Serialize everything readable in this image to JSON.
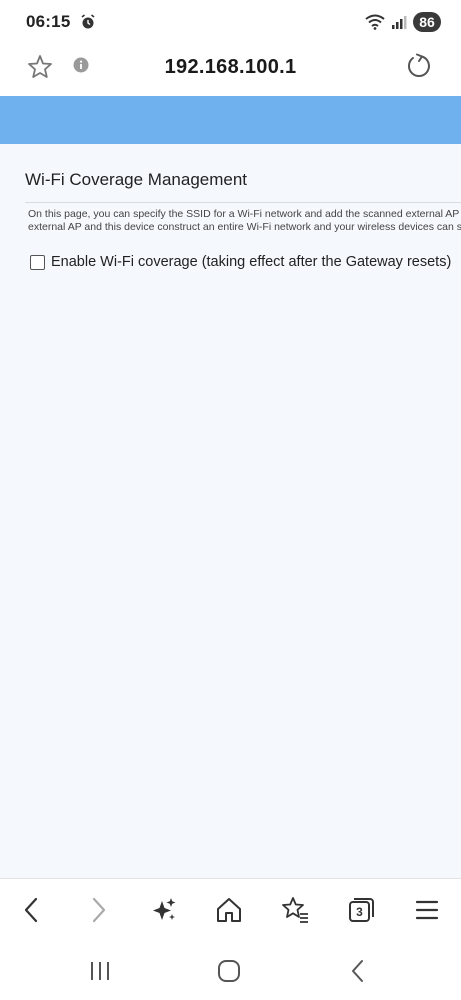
{
  "status_bar": {
    "time": "06:15",
    "battery": "86",
    "icons": [
      "alarm-icon",
      "wifi-icon",
      "signal-icon",
      "battery-icon"
    ]
  },
  "url_bar": {
    "url": "192.168.100.1",
    "icons": [
      "bookmark-star-icon",
      "info-icon",
      "reload-icon"
    ]
  },
  "page": {
    "title": "Wi-Fi Coverage Management",
    "description_line1": "On this page, you can specify the SSID for a Wi-Fi network and add the scanned external AP to",
    "description_line2": "external AP and this device construct an entire Wi-Fi network and your wireless devices can se",
    "checkbox_label": "Enable Wi-Fi coverage (taking effect after the Gateway resets)",
    "checkbox_checked": false
  },
  "toolbar": {
    "tabs_count": "3",
    "icons": [
      "back-icon",
      "forward-icon",
      "ai-sparkle-icon",
      "home-icon",
      "bookmarks-icon",
      "tabs-icon",
      "menu-icon"
    ]
  },
  "system_nav": {
    "icons": [
      "recent-apps-icon",
      "home-circle-icon",
      "system-back-icon"
    ]
  },
  "colors": {
    "header_band": "#6fb1ee",
    "page_background": "#f5f8fd"
  }
}
